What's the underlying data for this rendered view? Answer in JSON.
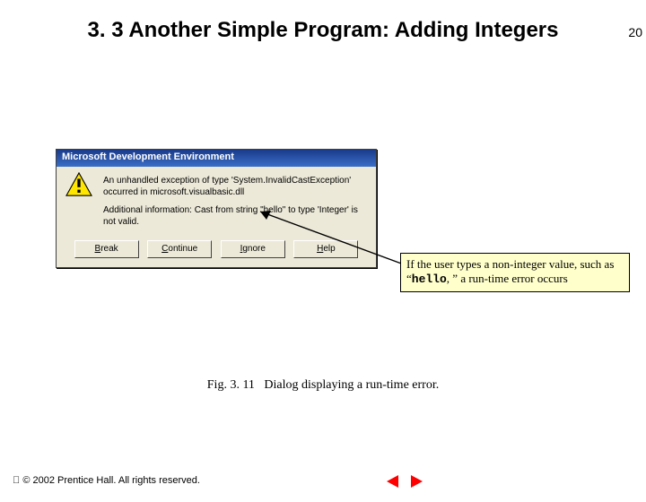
{
  "page_number": "20",
  "title": "3. 3 Another Simple Program: Adding Integers",
  "dialog": {
    "title": "Microsoft Development Environment",
    "message_main": "An unhandled exception of type 'System.InvalidCastException' occurred in microsoft.visualbasic.dll",
    "message_sub": "Additional information: Cast from string \"hello\" to type 'Integer' is not valid.",
    "buttons": {
      "break": "Break",
      "continue": "Continue",
      "ignore": "Ignore",
      "help": "Help"
    }
  },
  "callout": {
    "prefix": "If the user types a non-integer value, such as “",
    "code": "hello",
    "suffix": ", ” a run-time error occurs"
  },
  "caption_label": "Fig. 3. 11",
  "caption_text": "Dialog displaying a run-time error.",
  "footer": "© 2002 Prentice Hall. All rights reserved.",
  "nav_color": "#ff0000"
}
